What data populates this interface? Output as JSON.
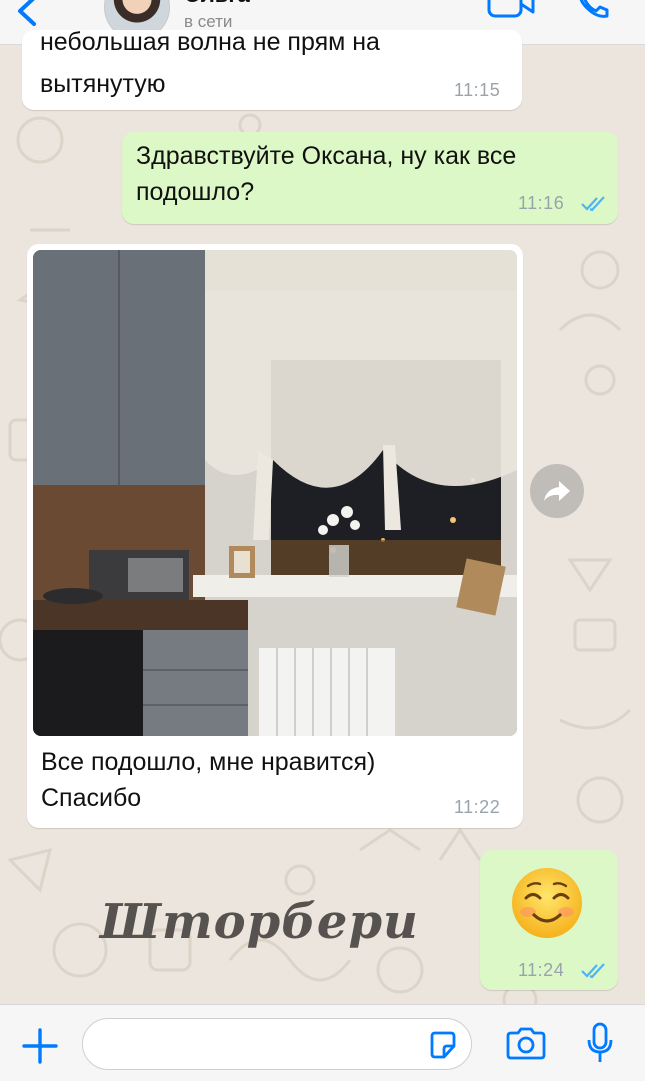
{
  "header": {
    "contact_name": "Ольга",
    "status": "в сети"
  },
  "messages": [
    {
      "direction": "incoming",
      "lines": [
        "небольшая волна не прям на",
        "вытянутую"
      ],
      "time": "11:15"
    },
    {
      "direction": "outgoing",
      "text": "Здравствуйте Оксана, ну как все подошло?",
      "time": "11:16",
      "read": true
    },
    {
      "direction": "incoming",
      "has_photo": true,
      "text_lines": [
        "Все подошло, мне нравится)",
        "Спасибо"
      ],
      "time": "11:22"
    },
    {
      "direction": "outgoing",
      "emoji": "smiling-face",
      "time": "11:24",
      "read": true
    }
  ],
  "watermark": "Шторбери",
  "input": {
    "value": "",
    "placeholder": ""
  },
  "colors": {
    "accent": "#007aff",
    "outgoing_bubble": "#dcf8c6",
    "incoming_bubble": "#ffffff",
    "wallpaper": "#ece5dd",
    "read_ticks": "#4fb3f6"
  },
  "icons": [
    "back-icon",
    "video-call-icon",
    "phone-icon",
    "forward-icon",
    "plus-icon",
    "sticker-icon",
    "camera-icon",
    "microphone-icon"
  ]
}
